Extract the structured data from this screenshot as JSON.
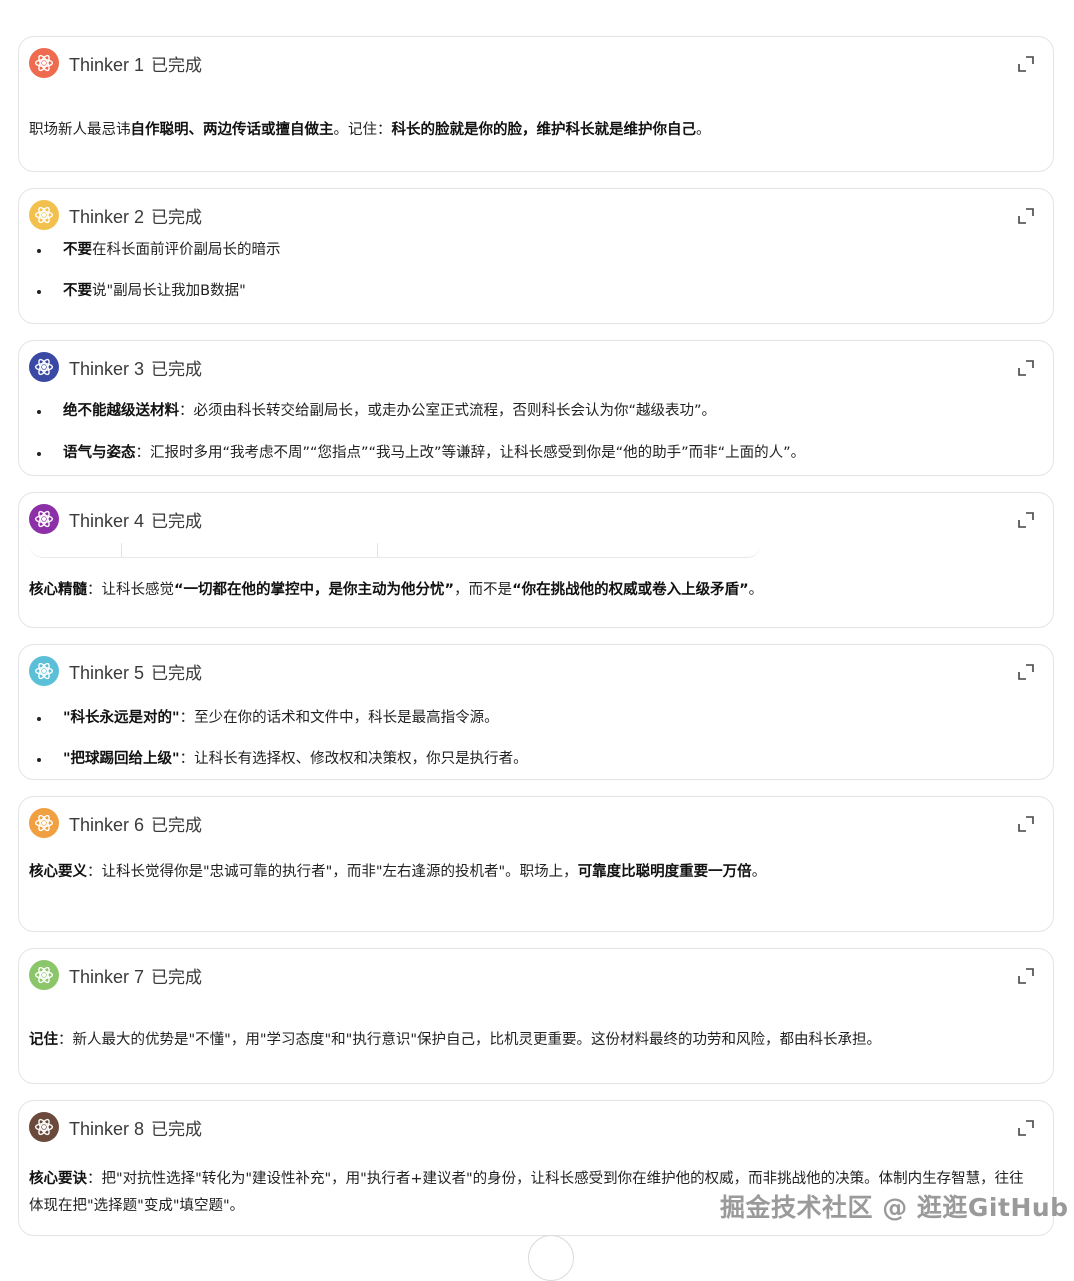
{
  "cards": [
    {
      "title": "Thinker 1",
      "status": "已完成",
      "color": "#ef6b4f",
      "paragraph": {
        "t1": "职场新人最忌讳",
        "b1": "自作聪明、两边传话或擅自做主",
        "t2": "。记住：",
        "b2": "科长的脸就是你的脸，维护科长就是维护你自己",
        "t3": "。"
      }
    },
    {
      "title": "Thinker 2",
      "status": "已完成",
      "color": "#f2c04c",
      "items": [
        {
          "b": "不要",
          "t": "在科长面前评价副局长的暗示"
        },
        {
          "b": "不要",
          "t": "说\"副局长让我加B数据\""
        }
      ]
    },
    {
      "title": "Thinker 3",
      "status": "已完成",
      "color": "#3a4aa4",
      "items": [
        {
          "b": "绝不能越级送材料",
          "t": "：必须由科长转交给副局长，或走办公室正式流程，否则科长会认为你“越级表功”。"
        },
        {
          "b": "语气与姿态",
          "t": "：汇报时多用“我考虑不周”“您指点”“我马上改”等谦辞，让科长感受到你是“他的助手”而非“上面的人”。"
        }
      ]
    },
    {
      "title": "Thinker 4",
      "status": "已完成",
      "color": "#8d2fa6",
      "paragraph": {
        "b1": "核心精髓",
        "t1": "：让科长感觉",
        "b2": "“一切都在他的掌控中，是你主动为他分忧”",
        "t2": "，而不是",
        "b3": "“你在挑战他的权威或卷入上级矛盾”",
        "t3": "。"
      }
    },
    {
      "title": "Thinker 5",
      "status": "已完成",
      "color": "#5bbfd8",
      "items": [
        {
          "b": "\"科长永远是对的\"",
          "t": "：至少在你的话术和文件中，科长是最高指令源。"
        },
        {
          "b": "\"把球踢回给上级\"",
          "t": "：让科长有选择权、修改权和决策权，你只是执行者。"
        }
      ]
    },
    {
      "title": "Thinker 6",
      "status": "已完成",
      "color": "#f0a040",
      "paragraph": {
        "b1": "核心要义",
        "t1": "：让科长觉得你是\"忠诚可靠的执行者\"，而非\"左右逢源的投机者\"。职场上，",
        "b2": "可靠度比聪明度重要一万倍",
        "t2": "。"
      }
    },
    {
      "title": "Thinker 7",
      "status": "已完成",
      "color": "#8cc66a",
      "paragraph": {
        "b1": "记住",
        "t1": "：新人最大的优势是\"不懂\"，用\"学习态度\"和\"执行意识\"保护自己，比机灵更重要。这份材料最终的功劳和风险，都由科长承担。"
      }
    },
    {
      "title": "Thinker 8",
      "status": "已完成",
      "color": "#6b4a3c",
      "paragraph": {
        "b1": "核心要诀",
        "t1": "：把\"对抗性选择\"转化为\"建设性补充\"，用\"执行者+建议者\"的身份，让科长感受到你在维护他的权威，而非挑战他的决策。体制内生存智慧，往往体现在把\"选择题\"变成\"填空题\"。"
      }
    }
  ],
  "watermark": "掘金技术社区 @ 逛逛GitHub",
  "icons": {
    "avatar": "atom-icon",
    "expand": "expand-icon"
  }
}
